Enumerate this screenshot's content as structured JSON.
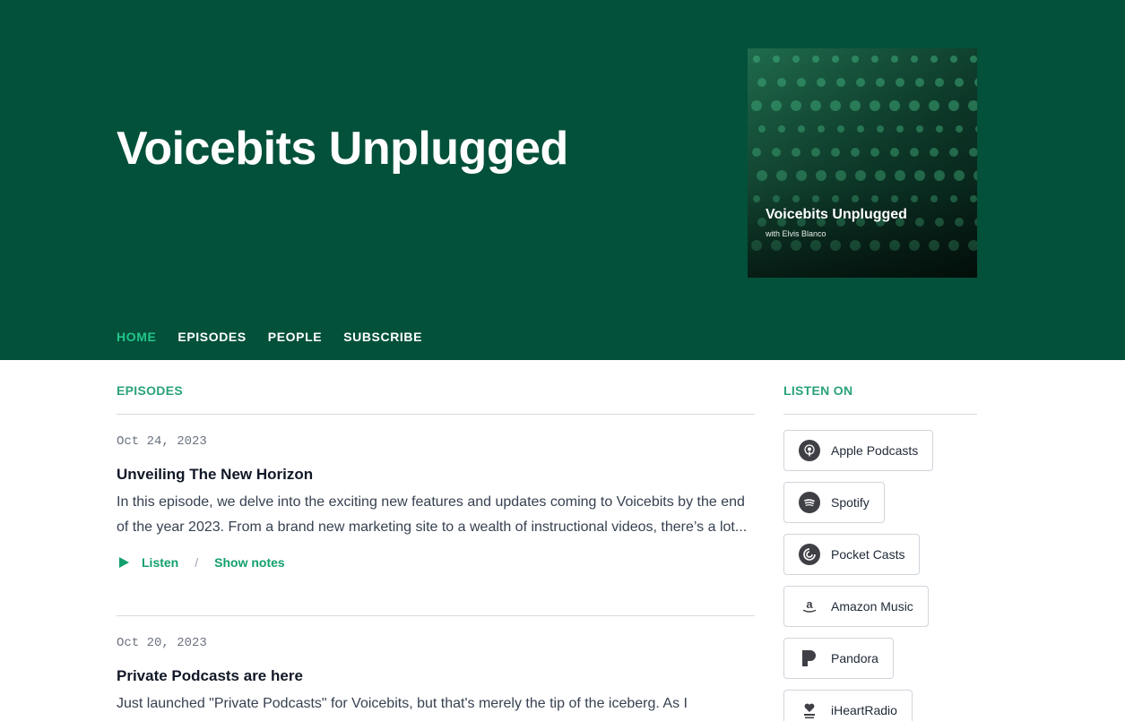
{
  "podcast": {
    "title": "Voicebits Unplugged",
    "cover_title": "Voicebits Unplugged",
    "cover_subtitle": "with Elvis Blanco"
  },
  "nav": {
    "items": [
      {
        "label": "HOME",
        "active": true
      },
      {
        "label": "EPISODES",
        "active": false
      },
      {
        "label": "PEOPLE",
        "active": false
      },
      {
        "label": "SUBSCRIBE",
        "active": false
      }
    ]
  },
  "episodes_section": {
    "heading": "EPISODES",
    "episodes": [
      {
        "date": "Oct 24, 2023",
        "title": "Unveiling The New Horizon",
        "description": "In this episode, we delve into the exciting new features and updates coming to Voicebits by the end of the year 2023. From a brand new marketing site to a wealth of instructional videos, there’s a lot...",
        "listen_label": "Listen",
        "separator": "/",
        "notes_label": "Show notes"
      },
      {
        "date": "Oct 20, 2023",
        "title": "Private Podcasts are here",
        "description": "Just launched \"Private Podcasts\" for Voicebits, but that's merely the tip of the iceberg. As I"
      }
    ]
  },
  "listen_on": {
    "heading": "LISTEN ON",
    "platforms": [
      {
        "label": "Apple Podcasts",
        "icon": "apple-podcasts-icon"
      },
      {
        "label": "Spotify",
        "icon": "spotify-icon"
      },
      {
        "label": "Pocket Casts",
        "icon": "pocket-casts-icon"
      },
      {
        "label": "Amazon Music",
        "icon": "amazon-music-icon"
      },
      {
        "label": "Pandora",
        "icon": "pandora-icon"
      },
      {
        "label": "iHeartRadio",
        "icon": "iheartradio-icon"
      }
    ]
  },
  "colors": {
    "hero_background": "#03513a",
    "accent": "#12a06c",
    "nav_active": "#22c58b"
  }
}
